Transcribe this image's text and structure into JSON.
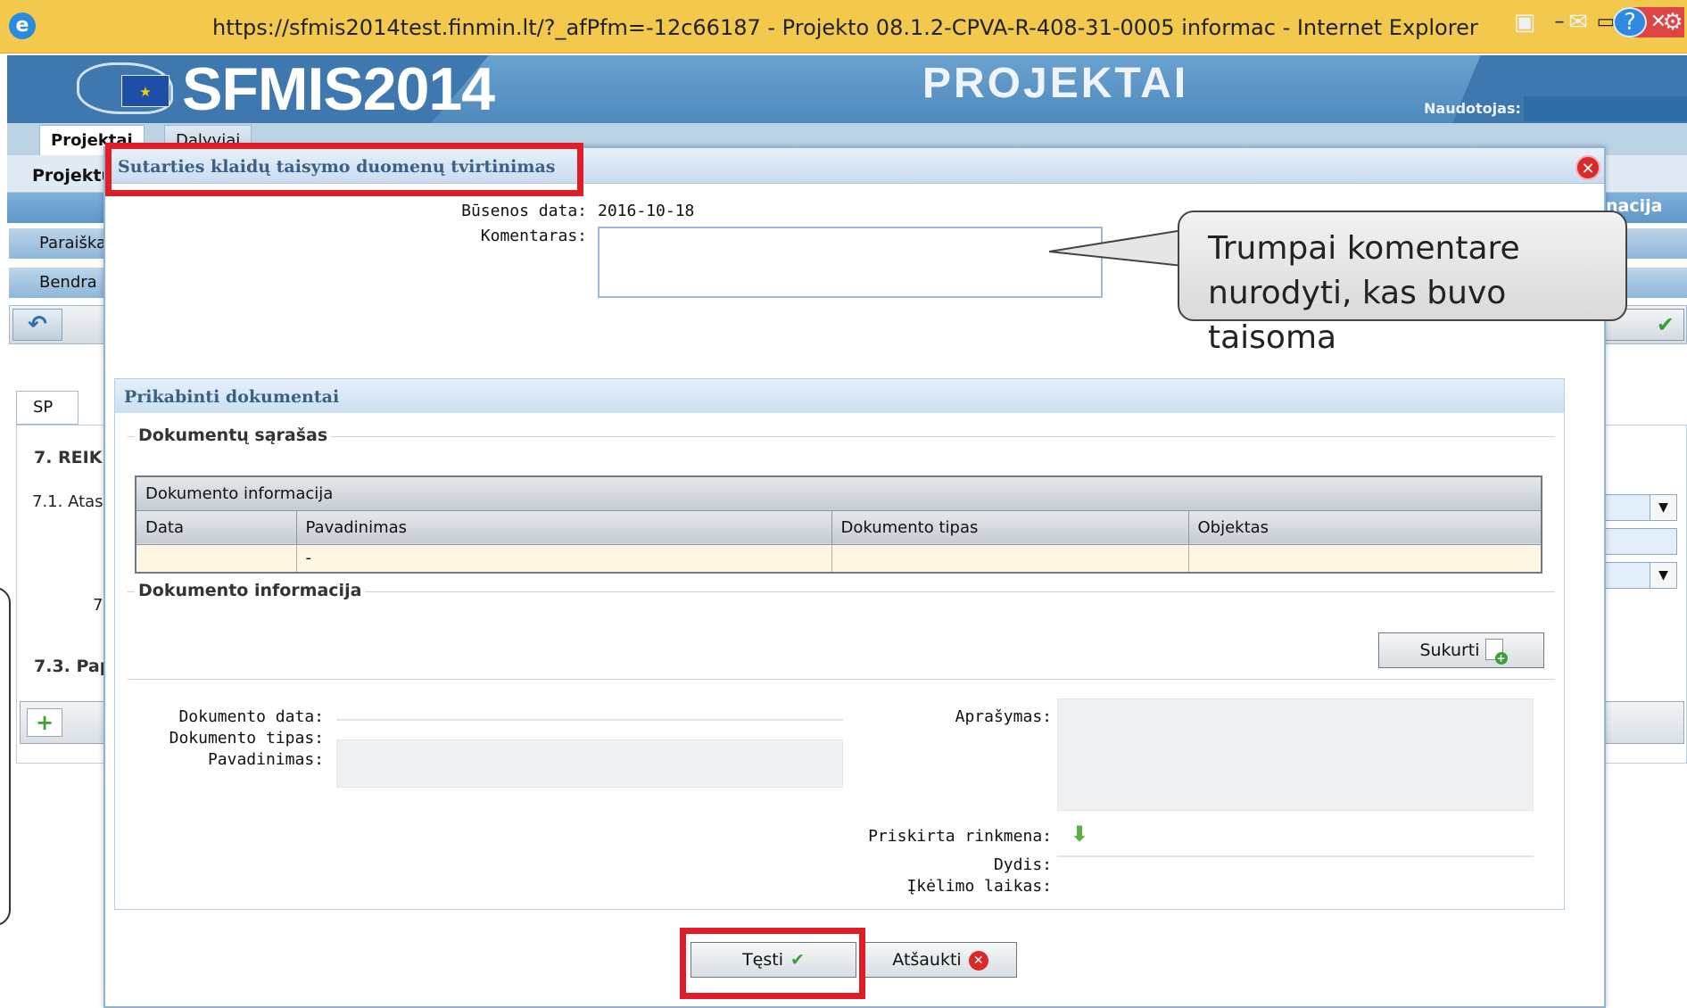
{
  "window": {
    "title": "https://sfmis2014test.finmin.lt/?_afPfm=-12c66187 - Projekto 08.1.2-CPVA-R-408-31-0005 informac - Internet Explorer",
    "min_symbol": "–",
    "max_symbol": "▭",
    "close_symbol": "✕"
  },
  "header": {
    "brand": "SFMIS2014",
    "module": "PROJEKTAI",
    "user_label": "Naudotojas:",
    "icons": [
      "chat-icon",
      "mail-icon",
      "help-icon",
      "gear-icon"
    ]
  },
  "background": {
    "tabs": [
      "Projektai",
      "Dalyviai"
    ],
    "project_label": "Projektu",
    "right_band_text": "nacija",
    "subtabs": [
      "Paraiška",
      "Bendra"
    ],
    "sp_tab": "SP",
    "section_7": "7. REIK",
    "line_71": "7.1. Atas",
    "line_7": "7",
    "section_73": "7.3. Pap"
  },
  "modal": {
    "title": "Sutarties klaidų taisymo duomenų tvirtinimas",
    "status_date_label": "Būsenos data:",
    "status_date_value": "2016-10-18",
    "comment_label": "Komentaras:",
    "comment_value": "",
    "attached_docs": {
      "title": "Prikabinti dokumentai",
      "list_legend": "Dokumentų sąrašas",
      "table": {
        "group_header": "Dokumento informacija",
        "columns": [
          "Data",
          "Pavadinimas",
          "Dokumento tipas",
          "Objektas"
        ],
        "rows": [
          [
            "",
            "-",
            "",
            ""
          ]
        ]
      },
      "info_legend": "Dokumento informacija",
      "create_button": "Sukurti",
      "fields": {
        "doc_date_label": "Dokumento data:",
        "doc_type_label": "Dokumento tipas:",
        "name_label": "Pavadinimas:",
        "description_label": "Aprašymas:",
        "assigned_file_label": "Priskirta rinkmena:",
        "size_label": "Dydis:",
        "upload_time_label": "Įkėlimo laikas:"
      }
    },
    "continue_button": "Tęsti",
    "cancel_button": "Atšaukti"
  },
  "annotation": {
    "callout_line1": "Trumpai komentare",
    "callout_line2": "nurodyti, kas buvo taisoma",
    "highlight_color": "#e11d2a"
  }
}
